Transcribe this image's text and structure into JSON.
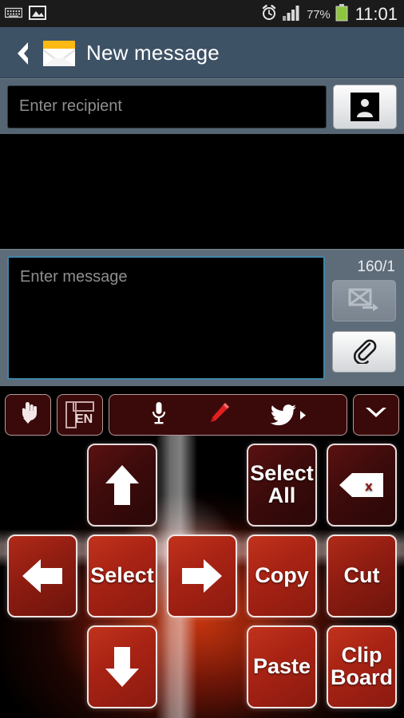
{
  "statusbar": {
    "icons": [
      "keyboard-icon",
      "image-icon",
      "alarm-clock-icon",
      "signal-bars-icon",
      "battery-icon"
    ],
    "battery_percent": "77%",
    "clock": "11:01"
  },
  "appbar": {
    "back_icon": "back-chevron-icon",
    "app_icon": "envelope-icon",
    "title": "New message"
  },
  "recipient": {
    "placeholder": "Enter recipient",
    "value": "",
    "contacts_button_icon": "contact-person-icon"
  },
  "compose": {
    "placeholder": "Enter message",
    "value": "",
    "char_counter": "160/1",
    "send_button_icon": "send-message-icon",
    "attach_button_icon": "paperclip-icon"
  },
  "keyboard": {
    "toolbar": [
      {
        "name": "handwriting-key",
        "icon": "hand-down-icon",
        "label": ""
      },
      {
        "name": "language-key",
        "icon": "layout-frame-icon",
        "label": "EN"
      },
      {
        "name": "input-methods-bar",
        "icon": "",
        "label": ""
      },
      {
        "name": "hide-keyboard-key",
        "icon": "chevron-down-icon",
        "label": ""
      }
    ],
    "toolbar_bar_icons": [
      "microphone-icon",
      "pencil-icon",
      "twitter-bird-icon"
    ],
    "keys": [
      {
        "name": "key-blank-1",
        "label": "",
        "style": "empty"
      },
      {
        "name": "key-arrow-up",
        "label": "",
        "style": "dark",
        "icon": "arrow-up-icon"
      },
      {
        "name": "key-blank-2",
        "label": "",
        "style": "empty"
      },
      {
        "name": "key-select-all",
        "label": "Select All",
        "style": "dark"
      },
      {
        "name": "key-backspace",
        "label": "",
        "style": "dark",
        "icon": "backspace-icon"
      },
      {
        "name": "key-arrow-left",
        "label": "",
        "style": "mid",
        "icon": "arrow-left-icon"
      },
      {
        "name": "key-select",
        "label": "Select",
        "style": "bright"
      },
      {
        "name": "key-arrow-right",
        "label": "",
        "style": "bright",
        "icon": "arrow-right-icon"
      },
      {
        "name": "key-copy",
        "label": "Copy",
        "style": "bright"
      },
      {
        "name": "key-cut",
        "label": "Cut",
        "style": "mid"
      },
      {
        "name": "key-blank-3",
        "label": "",
        "style": "empty"
      },
      {
        "name": "key-arrow-down",
        "label": "",
        "style": "bright",
        "icon": "arrow-down-icon"
      },
      {
        "name": "key-blank-4",
        "label": "",
        "style": "empty"
      },
      {
        "name": "key-paste",
        "label": "Paste",
        "style": "bright"
      },
      {
        "name": "key-clipboard",
        "label": "Clip Board",
        "style": "bright"
      }
    ]
  },
  "colors": {
    "appbar_bg": "#3e5266",
    "field_bar_bg": "#566573",
    "compose_bar_bg": "#5e6b78",
    "focus_border": "#3f86a8",
    "key_dark": "#3d0b0b",
    "key_bright": "#a92314",
    "status_bg": "#1b1b1b"
  }
}
